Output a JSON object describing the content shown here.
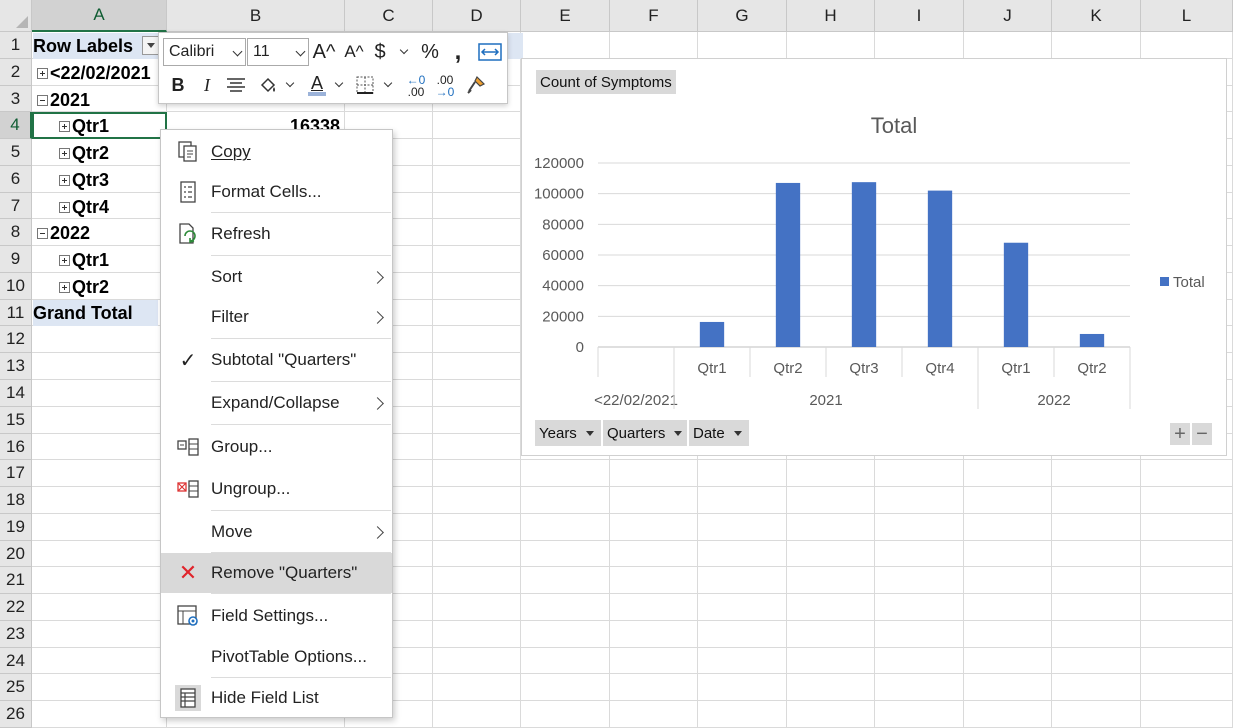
{
  "columns": [
    "A",
    "B",
    "C",
    "D",
    "E",
    "F",
    "G",
    "H",
    "I",
    "J",
    "K",
    "L"
  ],
  "rows": [
    "1",
    "2",
    "3",
    "4",
    "5",
    "6",
    "7",
    "8",
    "9",
    "10",
    "11",
    "12",
    "13",
    "14",
    "15",
    "16",
    "17",
    "18",
    "19",
    "20",
    "21",
    "22",
    "23",
    "24",
    "25",
    "26"
  ],
  "pivot": {
    "header": "Row Labels",
    "rows": [
      {
        "label": "<22/02/2021",
        "state": "plus",
        "level": 0
      },
      {
        "label": "2021",
        "state": "minus",
        "level": 0
      },
      {
        "label": "Qtr1",
        "state": "plus",
        "level": 1
      },
      {
        "label": "Qtr2",
        "state": "plus",
        "level": 1
      },
      {
        "label": "Qtr3",
        "state": "plus",
        "level": 1
      },
      {
        "label": "Qtr4",
        "state": "plus",
        "level": 1
      },
      {
        "label": "2022",
        "state": "minus",
        "level": 0
      },
      {
        "label": "Qtr1",
        "state": "plus",
        "level": 1
      },
      {
        "label": "Qtr2",
        "state": "plus",
        "level": 1
      }
    ],
    "grand_total": "Grand Total",
    "b4_value": "16338"
  },
  "mini_toolbar": {
    "font": "Calibri",
    "size": "11",
    "grow_icon": "A^",
    "shrink_icon": "A^",
    "currency": "$",
    "percent": "%",
    "comma": ",",
    "bold": "B",
    "italic": "I",
    "font_color": "A",
    "dec_inc_top": "←0",
    "dec_inc_bottom": ".00",
    "dec_dec_top": ".00",
    "dec_dec_bottom": "→0"
  },
  "context_menu": {
    "copy": "Copy",
    "format_cells": "Format Cells...",
    "refresh": "Refresh",
    "sort": "Sort",
    "filter": "Filter",
    "subtotal": "Subtotal \"Quarters\"",
    "expand_collapse": "Expand/Collapse",
    "group": "Group...",
    "ungroup": "Ungroup...",
    "move": "Move",
    "remove": "Remove \"Quarters\"",
    "field_settings": "Field Settings...",
    "pivot_options": "PivotTable Options...",
    "hide_field_list": "Hide Field List",
    "check_mark": "✓",
    "remove_mark": "✕"
  },
  "chart_panel": {
    "value_field": "Count of Symptoms",
    "field_buttons": [
      "Years",
      "Quarters",
      "Date"
    ],
    "zoom_in": "+",
    "zoom_out": "−"
  },
  "chart_data": {
    "type": "bar",
    "title": "Total",
    "categories": [
      "<22/02/2021",
      "Qtr1",
      "Qtr2",
      "Qtr3",
      "Qtr4",
      "Qtr1",
      "Qtr2"
    ],
    "groups": [
      {
        "name": "<22/02/2021",
        "span": 1
      },
      {
        "name": "2021",
        "span": 4
      },
      {
        "name": "2022",
        "span": 2
      }
    ],
    "series": [
      {
        "name": "Total",
        "values": [
          0,
          16338,
          107000,
          107500,
          102000,
          68000,
          8500
        ]
      }
    ],
    "ylim": [
      0,
      120000
    ],
    "yticks": [
      "0",
      "20000",
      "40000",
      "60000",
      "80000",
      "100000",
      "120000"
    ],
    "grid": true,
    "legend": "right",
    "bar_color": "#4472c4"
  }
}
